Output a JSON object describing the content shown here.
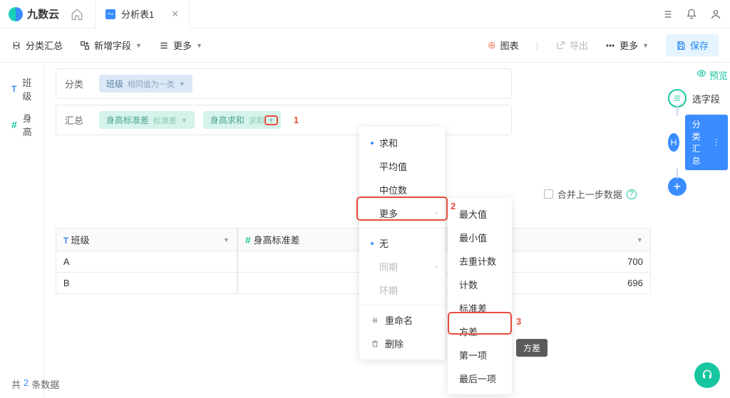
{
  "brand": "九数云",
  "tab": {
    "title": "分析表1"
  },
  "toolbar": {
    "group_summary": "分类汇总",
    "add_field": "新增字段",
    "more": "更多",
    "chart": "图表",
    "export": "导出",
    "more2": "更多",
    "save": "保存"
  },
  "fields": [
    {
      "type": "T",
      "name": "班级"
    },
    {
      "type": "#",
      "name": "身高"
    }
  ],
  "config": {
    "category_label": "分类",
    "summary_label": "汇总",
    "category_chip": {
      "name": "班级",
      "sub": "相同值为一类"
    },
    "summary_chips": [
      {
        "name": "身高标准差",
        "sub": "标准差"
      },
      {
        "name": "身高求和",
        "sub": "求和"
      }
    ]
  },
  "annotations": {
    "n1": "1",
    "n2": "2",
    "n3": "3"
  },
  "merge": {
    "label": "合并上一步数据"
  },
  "dropdown1": {
    "sum": "求和",
    "avg": "平均值",
    "median": "中位数",
    "more": "更多",
    "none": "无",
    "yoy": "同期",
    "mom": "环期",
    "rename": "重命名",
    "delete": "删除"
  },
  "dropdown2": {
    "max": "最大值",
    "min": "最小值",
    "distinct": "去重计数",
    "count": "计数",
    "stddev": "标准差",
    "variance": "方差",
    "first": "第一项",
    "last": "最后一项"
  },
  "tooltip_variance": "方差",
  "table": {
    "headers": {
      "c1": "班级",
      "c2": "身高标准差",
      "c3_partial": "700"
    },
    "rows": [
      {
        "c1": "A",
        "c3": "700"
      },
      {
        "c1": "B",
        "c3": "696"
      }
    ]
  },
  "footer": {
    "prefix": "共",
    "count": "2",
    "suffix": "条数据"
  },
  "right": {
    "preview": "预览",
    "step_select": "选字段",
    "step_summary": "分类汇总"
  }
}
